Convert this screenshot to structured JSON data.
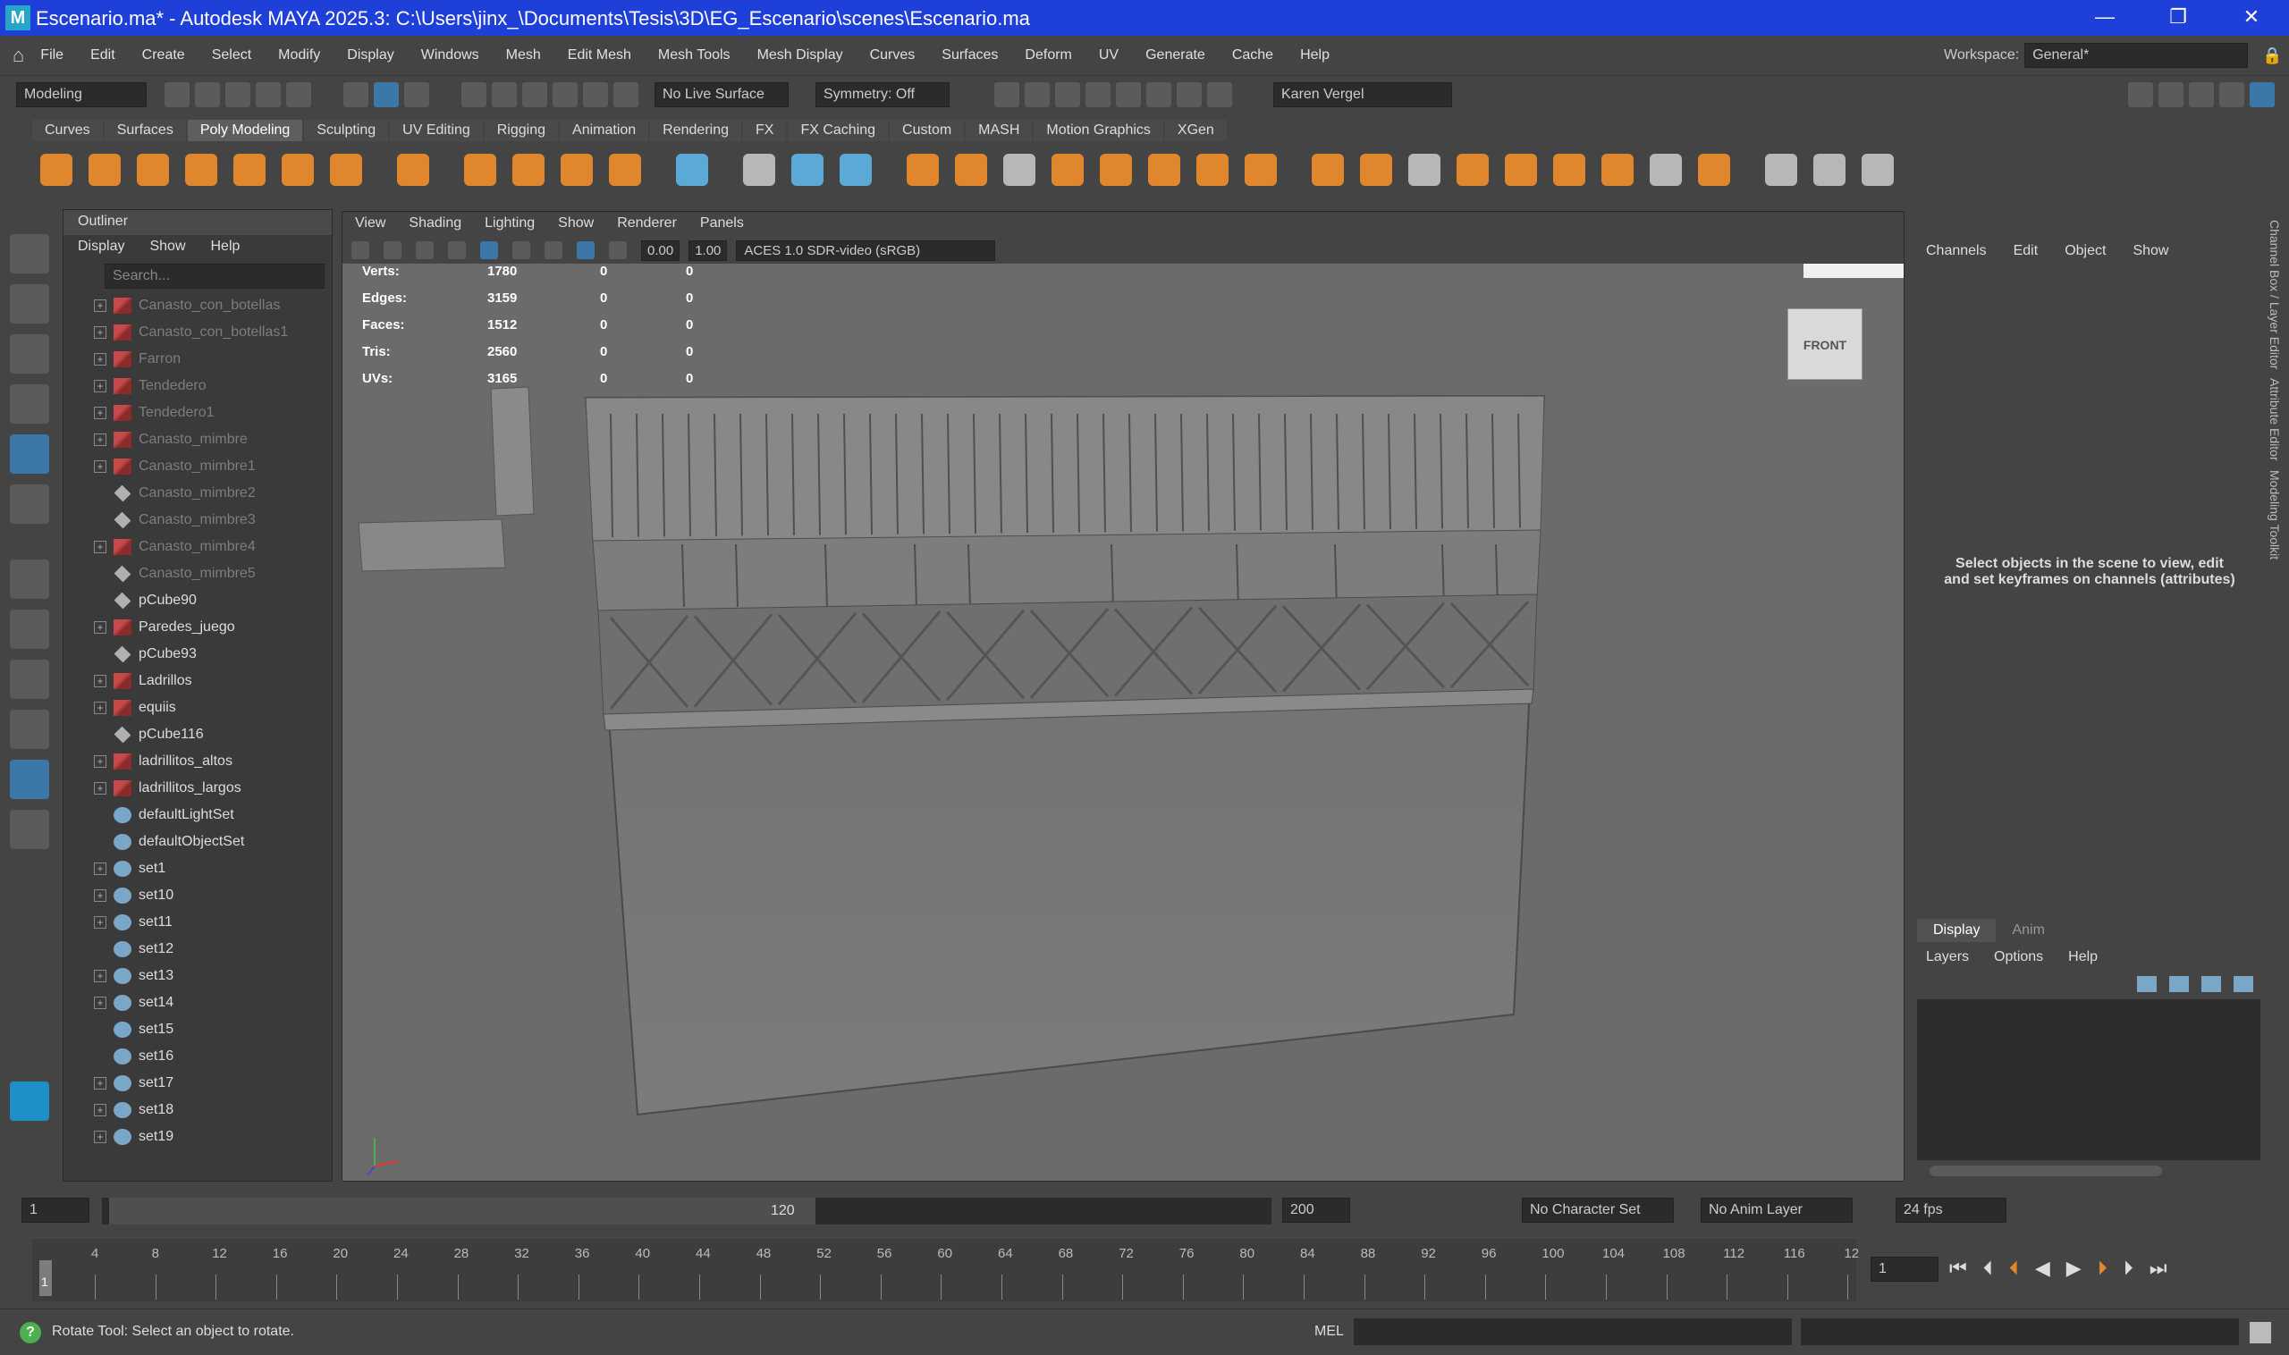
{
  "window": {
    "title": "Escenario.ma* - Autodesk MAYA 2025.3: C:\\Users\\jinx_\\Documents\\Tesis\\3D\\EG_Escenario\\scenes\\Escenario.ma",
    "logo": "M"
  },
  "menubar": {
    "items": [
      "File",
      "Edit",
      "Create",
      "Select",
      "Modify",
      "Display",
      "Windows",
      "Mesh",
      "Edit Mesh",
      "Mesh Tools",
      "Mesh Display",
      "Curves",
      "Surfaces",
      "Deform",
      "UV",
      "Generate",
      "Cache",
      "Help"
    ],
    "workspace_label": "Workspace:",
    "workspace_value": "General*"
  },
  "statusline": {
    "menuset": "Modeling",
    "live_surface": "No Live Surface",
    "symmetry": "Symmetry: Off",
    "user": "Karen Vergel"
  },
  "shelf": {
    "tabs": [
      "Curves",
      "Surfaces",
      "Poly Modeling",
      "Sculpting",
      "UV Editing",
      "Rigging",
      "Animation",
      "Rendering",
      "FX",
      "FX Caching",
      "Custom",
      "MASH",
      "Motion Graphics",
      "XGen"
    ],
    "active_tab": "Poly Modeling"
  },
  "outliner": {
    "title": "Outliner",
    "menu": [
      "Display",
      "Show",
      "Help"
    ],
    "search_placeholder": "Search...",
    "items": [
      {
        "name": "Canasto_con_botellas",
        "icon": "mesh",
        "expand": true,
        "dim": true
      },
      {
        "name": "Canasto_con_botellas1",
        "icon": "mesh",
        "expand": true,
        "dim": true
      },
      {
        "name": "Farron",
        "icon": "mesh",
        "expand": true,
        "dim": true
      },
      {
        "name": "Tendedero",
        "icon": "mesh",
        "expand": true,
        "dim": true
      },
      {
        "name": "Tendedero1",
        "icon": "mesh",
        "expand": true,
        "dim": true
      },
      {
        "name": "Canasto_mimbre",
        "icon": "mesh",
        "expand": true,
        "dim": true
      },
      {
        "name": "Canasto_mimbre1",
        "icon": "mesh",
        "expand": true,
        "dim": true
      },
      {
        "name": "Canasto_mimbre2",
        "icon": "cube",
        "expand": false,
        "dim": true
      },
      {
        "name": "Canasto_mimbre3",
        "icon": "cube",
        "expand": false,
        "dim": true
      },
      {
        "name": "Canasto_mimbre4",
        "icon": "mesh",
        "expand": true,
        "dim": true
      },
      {
        "name": "Canasto_mimbre5",
        "icon": "cube",
        "expand": false,
        "dim": true
      },
      {
        "name": "pCube90",
        "icon": "cube",
        "expand": false,
        "dim": false
      },
      {
        "name": "Paredes_juego",
        "icon": "mesh",
        "expand": true,
        "dim": false
      },
      {
        "name": "pCube93",
        "icon": "cube",
        "expand": false,
        "dim": false
      },
      {
        "name": "Ladrillos",
        "icon": "mesh",
        "expand": true,
        "dim": false
      },
      {
        "name": "equiis",
        "icon": "mesh",
        "expand": true,
        "dim": false
      },
      {
        "name": "pCube116",
        "icon": "cube",
        "expand": false,
        "dim": false
      },
      {
        "name": "ladrillitos_altos",
        "icon": "mesh",
        "expand": true,
        "dim": false
      },
      {
        "name": "ladrillitos_largos",
        "icon": "mesh",
        "expand": true,
        "dim": false
      },
      {
        "name": "defaultLightSet",
        "icon": "set",
        "expand": false,
        "dim": false
      },
      {
        "name": "defaultObjectSet",
        "icon": "set",
        "expand": false,
        "dim": false
      },
      {
        "name": "set1",
        "icon": "set",
        "expand": true,
        "dim": false
      },
      {
        "name": "set10",
        "icon": "set",
        "expand": true,
        "dim": false
      },
      {
        "name": "set11",
        "icon": "set",
        "expand": true,
        "dim": false
      },
      {
        "name": "set12",
        "icon": "set",
        "expand": false,
        "dim": false
      },
      {
        "name": "set13",
        "icon": "set",
        "expand": true,
        "dim": false
      },
      {
        "name": "set14",
        "icon": "set",
        "expand": true,
        "dim": false
      },
      {
        "name": "set15",
        "icon": "set",
        "expand": false,
        "dim": false
      },
      {
        "name": "set16",
        "icon": "set",
        "expand": false,
        "dim": false
      },
      {
        "name": "set17",
        "icon": "set",
        "expand": true,
        "dim": false
      },
      {
        "name": "set18",
        "icon": "set",
        "expand": true,
        "dim": false
      },
      {
        "name": "set19",
        "icon": "set",
        "expand": true,
        "dim": false
      }
    ]
  },
  "viewport": {
    "menu": [
      "View",
      "Shading",
      "Lighting",
      "Show",
      "Renderer",
      "Panels"
    ],
    "exposure": "0.00",
    "gamma": "1.00",
    "color_space": "ACES 1.0 SDR-video (sRGB)",
    "viewcube_label": "FRONT",
    "hud": [
      {
        "label": "Verts:",
        "a": "1780",
        "b": "0",
        "c": "0"
      },
      {
        "label": "Edges:",
        "a": "3159",
        "b": "0",
        "c": "0"
      },
      {
        "label": "Faces:",
        "a": "1512",
        "b": "0",
        "c": "0"
      },
      {
        "label": "Tris:",
        "a": "2560",
        "b": "0",
        "c": "0"
      },
      {
        "label": "UVs:",
        "a": "3165",
        "b": "0",
        "c": "0"
      }
    ]
  },
  "channelbox": {
    "menu": [
      "Channels",
      "Edit",
      "Object",
      "Show"
    ],
    "message": "Select objects in the scene to view, edit and set keyframes on channels (attributes)"
  },
  "layer_editor": {
    "tabs": [
      "Display",
      "Anim"
    ],
    "menu": [
      "Layers",
      "Options",
      "Help"
    ]
  },
  "side_tabs": [
    "Channel Box / Layer Editor",
    "Attribute Editor",
    "Modeling Toolkit"
  ],
  "range": {
    "start": "1",
    "range_start": "1",
    "range_end": "120",
    "end": "200",
    "character_set": "No Character Set",
    "anim_layer": "No Anim Layer",
    "fps": "24 fps"
  },
  "timeline": {
    "ticks": [
      "4",
      "8",
      "12",
      "16",
      "20",
      "24",
      "28",
      "32",
      "36",
      "40",
      "44",
      "48",
      "52",
      "56",
      "60",
      "64",
      "68",
      "72",
      "76",
      "80",
      "84",
      "88",
      "92",
      "96",
      "100",
      "104",
      "108",
      "112",
      "116",
      "12"
    ],
    "current_marker": "1",
    "current_frame": "1"
  },
  "helpline": {
    "message": "Rotate Tool: Select an object to rotate.",
    "cmd_label": "MEL"
  },
  "colors": {
    "titlebar": "#1e3fd8",
    "accent": "#3c77a8"
  }
}
